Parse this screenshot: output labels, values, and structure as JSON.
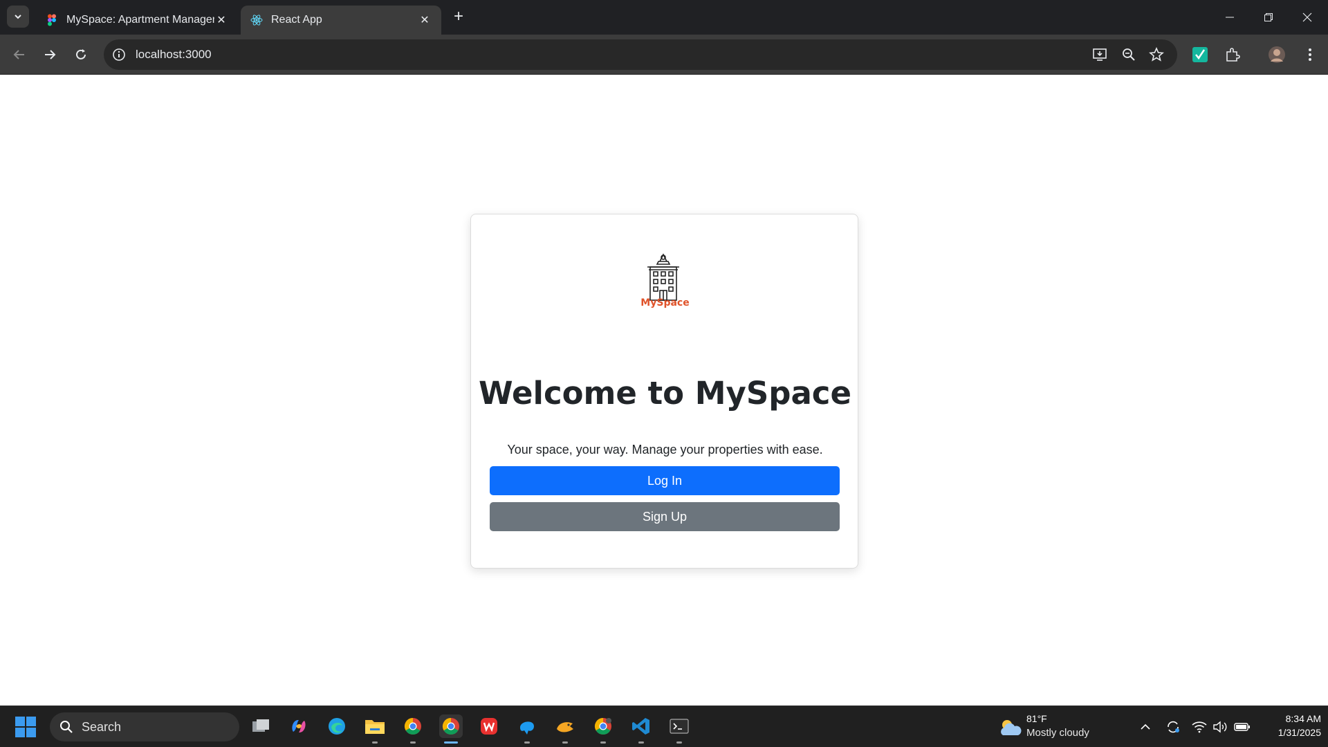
{
  "browser": {
    "tabs": [
      {
        "label": "MySpace: Apartment Managem",
        "active": false,
        "icon": "figma-icon"
      },
      {
        "label": "React App",
        "active": true,
        "icon": "react-icon"
      }
    ],
    "url": "localhost:3000"
  },
  "page": {
    "logo_text": "MySpace",
    "heading": "Welcome to MySpace",
    "tagline": "Your space, your way. Manage your properties with ease.",
    "login_label": "Log In",
    "signup_label": "Sign Up",
    "login_color": "#0d6efd",
    "signup_color": "#6c757d",
    "brand_color": "#e0532a"
  },
  "taskbar": {
    "search_label": "Search",
    "weather_temp": "81°F",
    "weather_condition": "Mostly cloudy",
    "time": "8:34 AM",
    "date": "1/31/2025",
    "apps": [
      "task-view-icon",
      "copilot-icon",
      "edge-icon",
      "file-explorer-icon",
      "chrome-icon",
      "chrome-active-icon",
      "wps-icon",
      "app-blue-icon",
      "app-yellow-icon",
      "chrome-alt-icon",
      "vscode-icon",
      "terminal-icon"
    ]
  }
}
